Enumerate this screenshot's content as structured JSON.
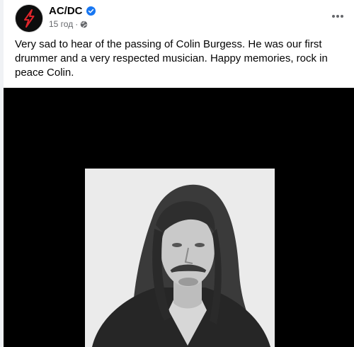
{
  "post": {
    "page_name": "AC/DC",
    "time": "15 год",
    "meta_separator": "·",
    "text": "Very sad to hear of the passing of Colin Burgess. He was our first drummer and a very respected musician. Happy memories, rock in peace Colin."
  },
  "icons": {
    "avatar": "acdc-lightning-logo",
    "verified": "verified-badge-icon",
    "audience": "globe-icon",
    "menu": "more-horizontal-icon"
  },
  "colors": {
    "brand_red": "#e0252b",
    "verified_blue": "#1877f2",
    "secondary_text": "#65676b",
    "media_background": "#000000"
  }
}
